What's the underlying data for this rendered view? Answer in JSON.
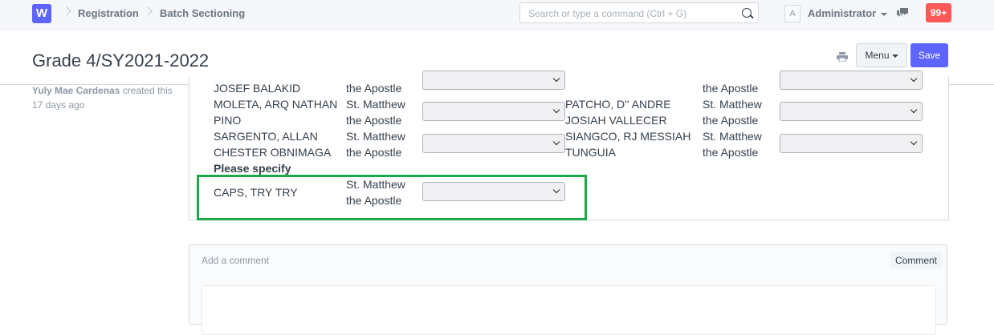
{
  "navbar": {
    "logo": "W",
    "breadcrumbs": [
      "Registration",
      "Batch Sectioning"
    ],
    "search_placeholder": "Search or type a command (Ctrl + G)",
    "avatar_letter": "A",
    "user_name": "Administrator",
    "notifications": "99+"
  },
  "page": {
    "title": "Grade 4/SY2021-2022",
    "menu_label": "Menu",
    "save_label": "Save"
  },
  "sidebar": {
    "author": "Yuly Mae Cardenas",
    "created_text": "created this",
    "age": "17 days ago"
  },
  "students_left": [
    {
      "name_l1": "JOSEF BALAKID",
      "name_l2": "",
      "section_l1": "the Apostle",
      "section_l2": ""
    },
    {
      "name_l1": "MOLETA, ARQ NATHAN",
      "name_l2": "PINO",
      "section_l1": "St. Matthew",
      "section_l2": "the Apostle"
    },
    {
      "name_l1": "SARGENTO, ALLAN",
      "name_l2": "CHESTER OBNIMAGA",
      "section_l1": "St. Matthew",
      "section_l2": "the Apostle"
    }
  ],
  "students_right": [
    {
      "name_l1": "",
      "name_l2": "",
      "section_l1": "the Apostle",
      "section_l2": ""
    },
    {
      "name_l1": "PATCHO, D'' ANDRE",
      "name_l2": "JOSIAH VALLECER",
      "section_l1": "St. Matthew",
      "section_l2": "the Apostle"
    },
    {
      "name_l1": "SIANGCO, RJ MESSIAH",
      "name_l2": "TUNGUIA",
      "section_l1": "St. Matthew",
      "section_l2": "the Apostle"
    }
  ],
  "specify_heading": "Please specify",
  "specify_row": {
    "name": "CAPS, TRY TRY",
    "section_l1": "St. Matthew",
    "section_l2": "the Apostle"
  },
  "comments": {
    "placeholder": "Add a comment",
    "button_label": "Comment"
  },
  "colors": {
    "brand": "#5e64ff",
    "badge": "#ff5858",
    "highlight": "#1ea84a"
  }
}
